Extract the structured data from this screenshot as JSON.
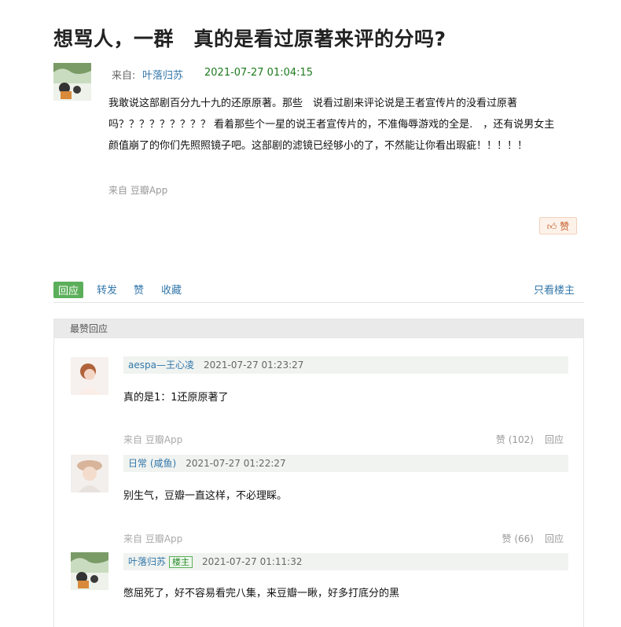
{
  "post": {
    "title": "想骂人，一群　真的是看过原著来评的分吗?",
    "from_label": "来自:",
    "author": "叶落归苏",
    "time": "2021-07-27 01:04:15",
    "body_line1": "我敢说这部剧百分九十九的还原原著。那些　说看过剧来评论说是王者宣传片的没看过原著",
    "body_line2": "吗？？？？？？？？？ 看着那些个一星的说王者宣传片的，不准侮辱游戏的全是.　，还有说男女主",
    "body_line3": "颜值崩了的你们先照照镜子吧。这部剧的滤镜已经够小的了，不然能让你看出瑕疵！！！！！",
    "source": "来自 豆瓣App",
    "like_label": "赞"
  },
  "actions": {
    "reply": "回应",
    "forward": "转发",
    "like": "赞",
    "collect": "收藏",
    "only_owner": "只看楼主"
  },
  "best_replies": {
    "header": "最赞回应",
    "items": [
      {
        "author": "aespa—王心凌",
        "time": "2021-07-27 01:23:27",
        "text": "真的是1：1还原原著了",
        "source": "来自 豆瓣App",
        "likes": "赞 (102)",
        "reply": "回应"
      },
      {
        "author": "日常 (咸鱼)",
        "time": "2021-07-27 01:22:27",
        "text": "别生气，豆瓣一直这样，不必理睬。",
        "source": "来自 豆瓣App",
        "likes": "赞 (66)",
        "reply": "回应"
      },
      {
        "author": "叶落归苏",
        "owner_tag": "楼主",
        "time": "2021-07-27 01:11:32",
        "text": "憋屈死了，好不容易看完八集，来豆瓣一瞅，好多打底分的黑"
      }
    ]
  },
  "colors": {
    "link": "#3377aa",
    "time_green": "#1d7a1d",
    "reply_button": "#5caf5a",
    "like_button_bg": "#fdf2ea"
  }
}
